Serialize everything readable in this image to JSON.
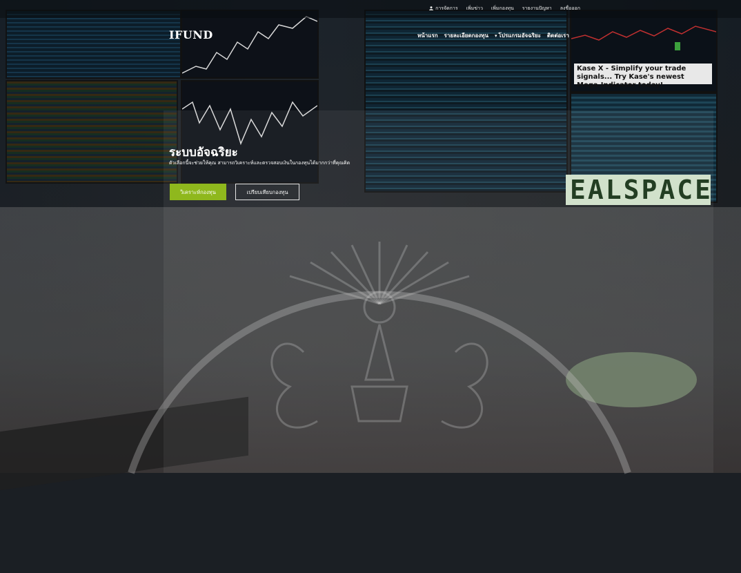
{
  "topbar": {
    "links": [
      "การจัดการ",
      "เพิ่มข่าว",
      "เพิ่มกองทุน",
      "รายงานปัญหา",
      "ลงชื่อออก"
    ]
  },
  "nav": {
    "brand": "IFUND",
    "items": [
      "หน้าแรก",
      "รายละเอียดกองทุน",
      "โปรแกรมอัจฉริยะ",
      "ติดต่อเรา"
    ]
  },
  "hero": {
    "title": "ระบบอัจฉริยะ",
    "subtitle": "ตัวเลือกนี้จะช่วยให้คุณ สามารถวิเคราะห์และตรวจสอบเงินในกองทุนได้มากกว่าที่คุณคิด",
    "primary_button": "วิเคราะห์กองทุน",
    "secondary_button": "เปรียบเทียบกองทุน"
  },
  "background": {
    "ad_text": "Kase X - Simplify your trade signals... Try Kase's newest Mega-Indicator today!",
    "sign_text": "EALSPACE"
  },
  "colors": {
    "accent": "#8fb81d",
    "topbar_bg": "#0a0c10"
  },
  "icons": {
    "user": "user-icon",
    "dropdown": "caret-down-icon"
  }
}
